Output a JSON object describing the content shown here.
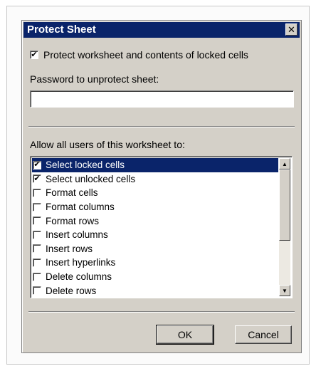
{
  "dialog": {
    "title": "Protect Sheet",
    "close_glyph": "✕",
    "protect_checkbox": {
      "label": "Protect worksheet and contents of locked cells",
      "checked": true
    },
    "password": {
      "label": "Password to unprotect sheet:",
      "value": ""
    },
    "allow_label": "Allow all users of this worksheet to:",
    "permissions": [
      {
        "label": "Select locked cells",
        "checked": true,
        "selected": true
      },
      {
        "label": "Select unlocked cells",
        "checked": true,
        "selected": false
      },
      {
        "label": "Format cells",
        "checked": false,
        "selected": false
      },
      {
        "label": "Format columns",
        "checked": false,
        "selected": false
      },
      {
        "label": "Format rows",
        "checked": false,
        "selected": false
      },
      {
        "label": "Insert columns",
        "checked": false,
        "selected": false
      },
      {
        "label": "Insert rows",
        "checked": false,
        "selected": false
      },
      {
        "label": "Insert hyperlinks",
        "checked": false,
        "selected": false
      },
      {
        "label": "Delete columns",
        "checked": false,
        "selected": false
      },
      {
        "label": "Delete rows",
        "checked": false,
        "selected": false
      }
    ],
    "ok_label": "OK",
    "cancel_label": "Cancel",
    "check_glyph": "✔",
    "scroll_up_glyph": "▲",
    "scroll_down_glyph": "▼",
    "colors": {
      "title_bar": "#0a246a",
      "dialog_bg": "#d4d0c8",
      "selection": "#0a246a"
    }
  }
}
